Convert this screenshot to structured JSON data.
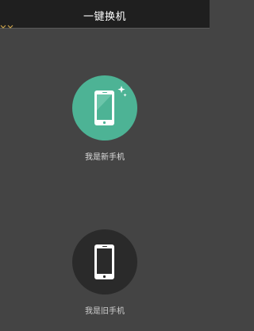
{
  "header": {
    "title": "一键换机"
  },
  "options": {
    "new_phone": {
      "label": "我是新手机",
      "icon": "smartphone-sparkle-icon",
      "color": "#4db395"
    },
    "old_phone": {
      "label": "我是旧手机",
      "icon": "smartphone-icon",
      "color": "#2a2a2a"
    }
  },
  "colors": {
    "background": "#444444",
    "titlebar": "#1f1f1f"
  }
}
